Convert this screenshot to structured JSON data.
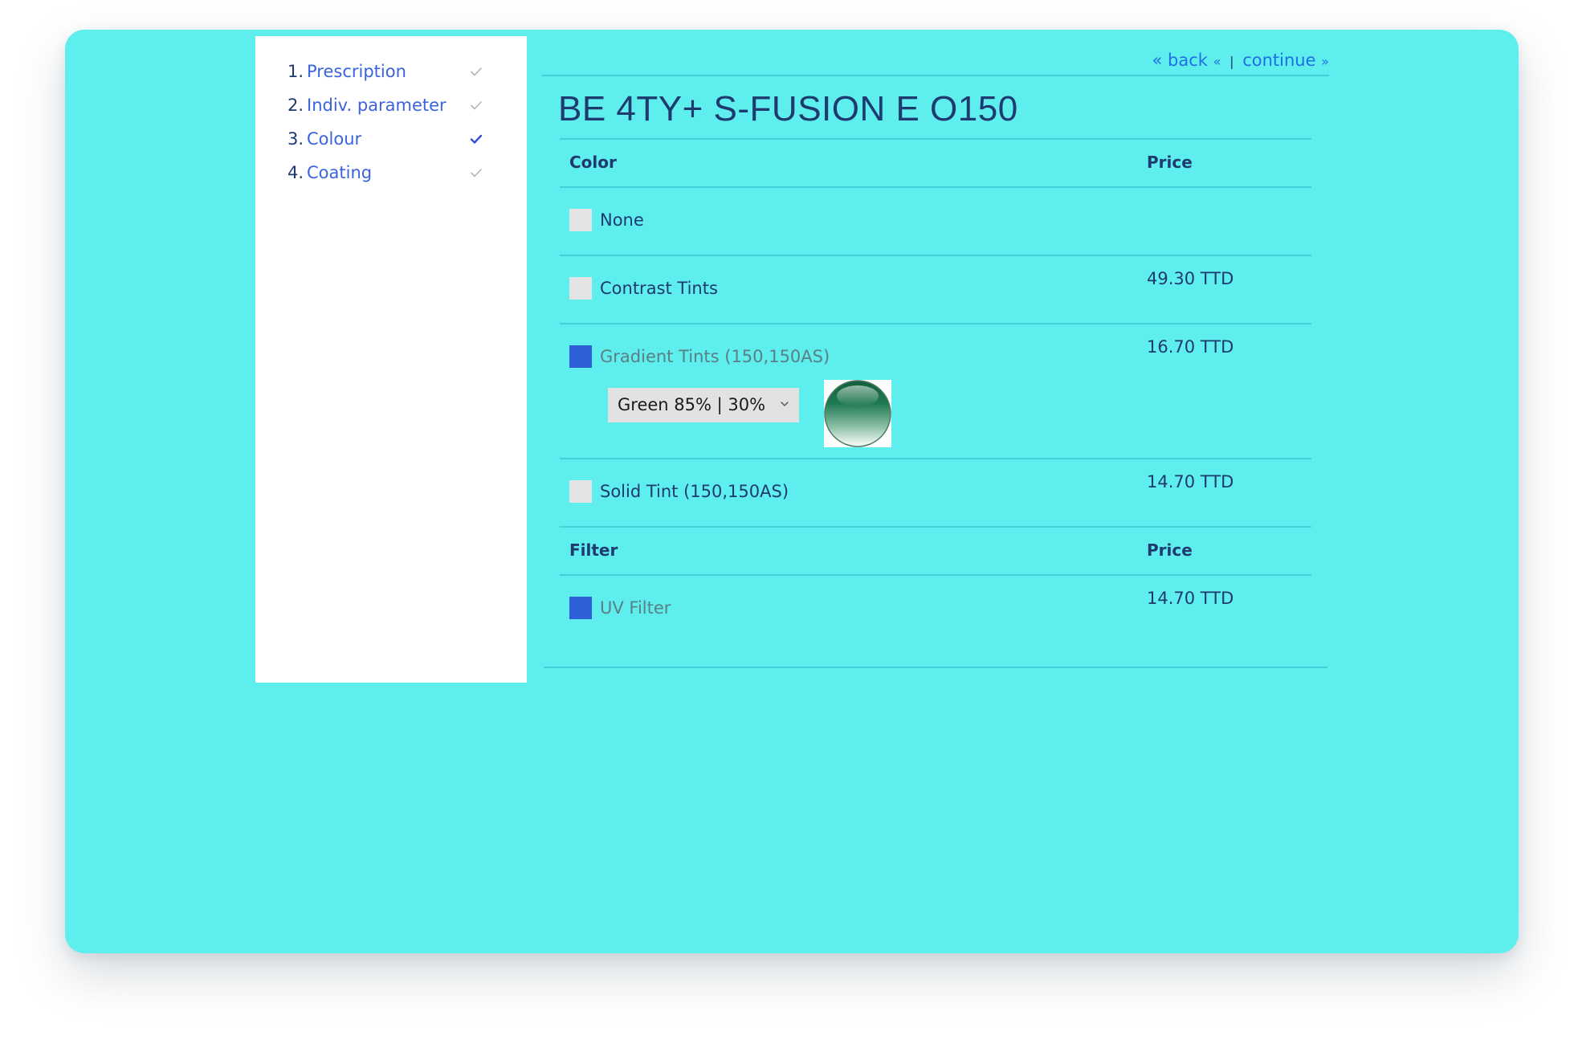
{
  "steps": [
    {
      "number": "1.",
      "label": "Prescription",
      "checked": false
    },
    {
      "number": "2.",
      "label": "Indiv. parameter",
      "checked": false
    },
    {
      "number": "3.",
      "label": "Colour",
      "checked": true
    },
    {
      "number": "4.",
      "label": "Coating",
      "checked": false
    }
  ],
  "nav": {
    "back_label": "« back",
    "back_suffix": "«",
    "separator": "|",
    "continue_label": "continue",
    "continue_suffix": "»"
  },
  "product": {
    "title": "BE 4TY+ S-FUSION E O150"
  },
  "color_section": {
    "header": "Color",
    "price_header": "Price",
    "options": [
      {
        "label": "None",
        "price": "",
        "selected": false
      },
      {
        "label": "Contrast Tints",
        "price": "49.30 TTD",
        "selected": false
      },
      {
        "label": "Gradient Tints (150,150AS)",
        "price": "16.70 TTD",
        "selected": true,
        "shade": {
          "value": "Green 85% | 30%",
          "icon": "chevron-down-icon"
        }
      },
      {
        "label": "Solid Tint (150,150AS)",
        "price": "14.70 TTD",
        "selected": false
      }
    ]
  },
  "filter_section": {
    "header": "Filter",
    "price_header": "Price",
    "options": [
      {
        "label": "UV Filter",
        "price": "14.70 TTD",
        "selected": true
      }
    ]
  },
  "colors": {
    "panel_bg": "#5eeeee",
    "link": "#3a63dd",
    "text": "#1f3a6e",
    "checkbox_on": "#2f5fd6",
    "checkbox_off": "#e3e3e3",
    "lens_green": "#1f7a52"
  }
}
